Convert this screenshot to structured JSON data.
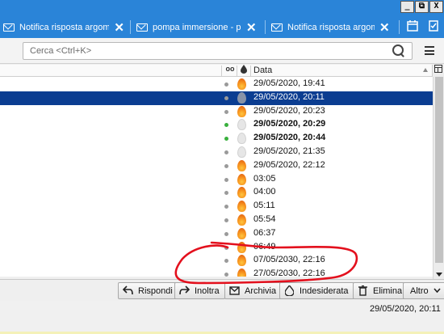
{
  "window": {
    "controls": [
      "_",
      "⧉",
      "X"
    ]
  },
  "tabs": [
    {
      "label": "Notifica risposta argomen",
      "close": "✕"
    },
    {
      "label": "pompa immersione - pre",
      "close": "✕"
    },
    {
      "label": "Notifica risposta argomen",
      "close": "✕"
    }
  ],
  "tab_icons": [
    "calendar-icon",
    "tasks-icon"
  ],
  "search": {
    "placeholder": "Cerca <Ctrl+K>"
  },
  "columns": {
    "read": "oo",
    "flame": "▲",
    "date": "Data"
  },
  "messages": [
    {
      "date": "29/05/2020, 19:41",
      "dot": "grey",
      "flame": "orange",
      "bold": false,
      "selected": false
    },
    {
      "date": "29/05/2020, 20:11",
      "dot": "grey",
      "flame": "selected",
      "bold": false,
      "selected": true
    },
    {
      "date": "29/05/2020, 20:23",
      "dot": "grey",
      "flame": "orange",
      "bold": false,
      "selected": false
    },
    {
      "date": "29/05/2020, 20:29",
      "dot": "green",
      "flame": "pale",
      "bold": true,
      "selected": false
    },
    {
      "date": "29/05/2020, 20:44",
      "dot": "green",
      "flame": "pale",
      "bold": true,
      "selected": false
    },
    {
      "date": "29/05/2020, 21:35",
      "dot": "grey",
      "flame": "pale",
      "bold": false,
      "selected": false
    },
    {
      "date": "29/05/2020, 22:12",
      "dot": "grey",
      "flame": "orange",
      "bold": false,
      "selected": false
    },
    {
      "date": "03:05",
      "dot": "grey",
      "flame": "orange",
      "bold": false,
      "selected": false
    },
    {
      "date": "04:00",
      "dot": "grey",
      "flame": "orange",
      "bold": false,
      "selected": false
    },
    {
      "date": "05:11",
      "dot": "grey",
      "flame": "orange",
      "bold": false,
      "selected": false
    },
    {
      "date": "05:54",
      "dot": "grey",
      "flame": "orange",
      "bold": false,
      "selected": false
    },
    {
      "date": "06:37",
      "dot": "grey",
      "flame": "orange",
      "bold": false,
      "selected": false
    },
    {
      "date": "06:49",
      "dot": "grey",
      "flame": "orange",
      "bold": false,
      "selected": false
    },
    {
      "date": "07/05/2030, 22:16",
      "dot": "grey",
      "flame": "orange",
      "bold": false,
      "selected": false
    },
    {
      "date": "27/05/2030, 22:16",
      "dot": "grey",
      "flame": "orange",
      "bold": false,
      "selected": false
    }
  ],
  "actions": {
    "reply": {
      "label": "Rispondi",
      "icon": "reply-icon"
    },
    "forward": {
      "label": "Inoltra",
      "icon": "forward-icon"
    },
    "archive": {
      "label": "Archivia",
      "icon": "archive-icon"
    },
    "junk": {
      "label": "Indesiderata",
      "icon": "junk-icon"
    },
    "delete": {
      "label": "Elimina",
      "icon": "trash-icon"
    },
    "more": {
      "label": "Altro",
      "icon": "chevron-down-icon"
    }
  },
  "message_date": "29/05/2020, 20:11",
  "colors": {
    "titlebar": "#2a84d8",
    "selection": "#0b3d91",
    "annotation": "#e3101d"
  }
}
